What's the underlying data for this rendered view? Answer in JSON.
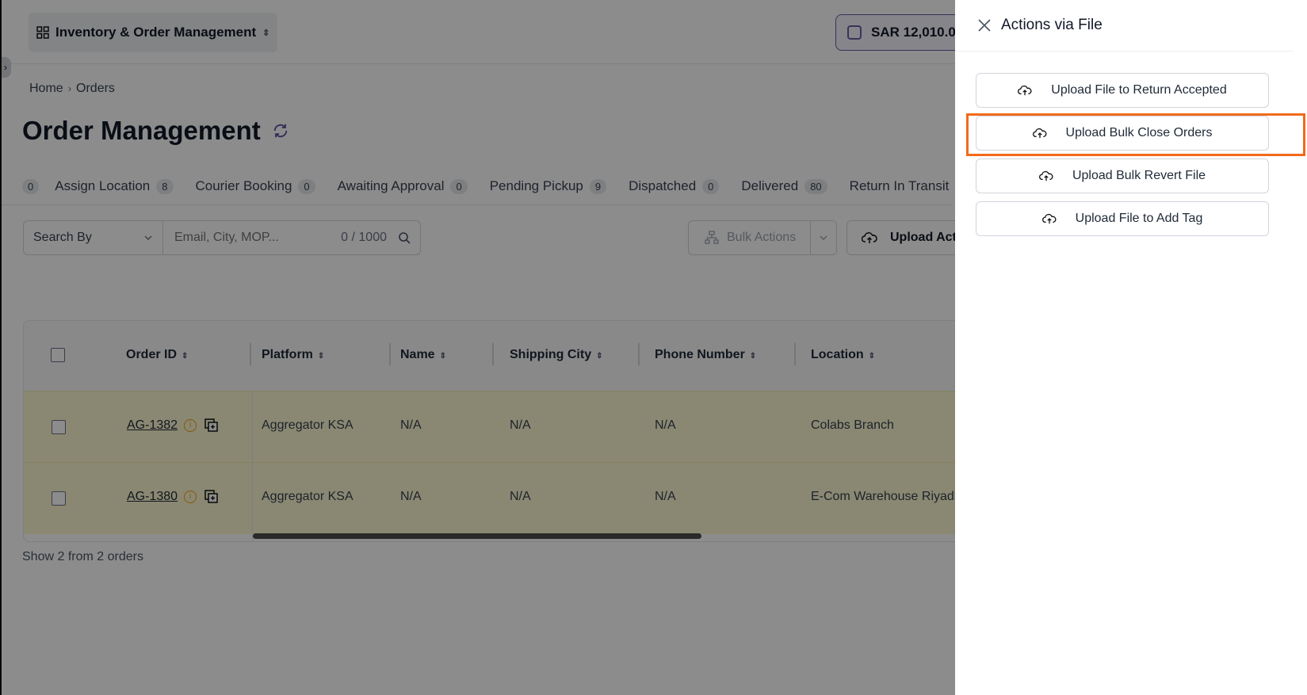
{
  "header": {
    "app_switcher_label": "Inventory & Order Management",
    "wallet_balance": "SAR 12,010.0"
  },
  "breadcrumb": {
    "home": "Home",
    "current": "Orders"
  },
  "page": {
    "title": "Order Management"
  },
  "tabs": [
    {
      "label": "",
      "count": "0"
    },
    {
      "label": "Assign Location",
      "count": "8"
    },
    {
      "label": "Courier Booking",
      "count": "0"
    },
    {
      "label": "Awaiting Approval",
      "count": "0"
    },
    {
      "label": "Pending Pickup",
      "count": "9"
    },
    {
      "label": "Dispatched",
      "count": "0"
    },
    {
      "label": "Delivered",
      "count": "80"
    },
    {
      "label": "Return In Transit",
      "count": ""
    }
  ],
  "toolbar": {
    "search_by_label": "Search By",
    "search_placeholder": "Email, City, MOP...",
    "search_count": "0 / 1000",
    "bulk_actions_label": "Bulk Actions",
    "upload_actions_label": "Upload Act"
  },
  "table": {
    "columns": [
      "Order ID",
      "Platform",
      "Name",
      "Shipping City",
      "Phone Number",
      "Location"
    ],
    "rows": [
      {
        "order_id": "AG-1382",
        "platform": "Aggregator KSA",
        "name": "N/A",
        "shipping_city": "N/A",
        "phone": "N/A",
        "location": "Colabs Branch"
      },
      {
        "order_id": "AG-1380",
        "platform": "Aggregator KSA",
        "name": "N/A",
        "shipping_city": "N/A",
        "phone": "N/A",
        "location": "E-Com Warehouse Riyadh"
      }
    ]
  },
  "footer": {
    "summary": "Show 2 from 2 orders"
  },
  "drawer": {
    "title": "Actions via File",
    "buttons": [
      "Upload File to Return Accepted",
      "Upload Bulk Close Orders",
      "Upload Bulk Revert File",
      "Upload File to Add Tag"
    ]
  },
  "colors": {
    "accent_purple": "#6b5ca5",
    "row_highlight": "#fbf8d0",
    "warning": "#f59e0b",
    "focus_outline": "#f26a1b"
  }
}
